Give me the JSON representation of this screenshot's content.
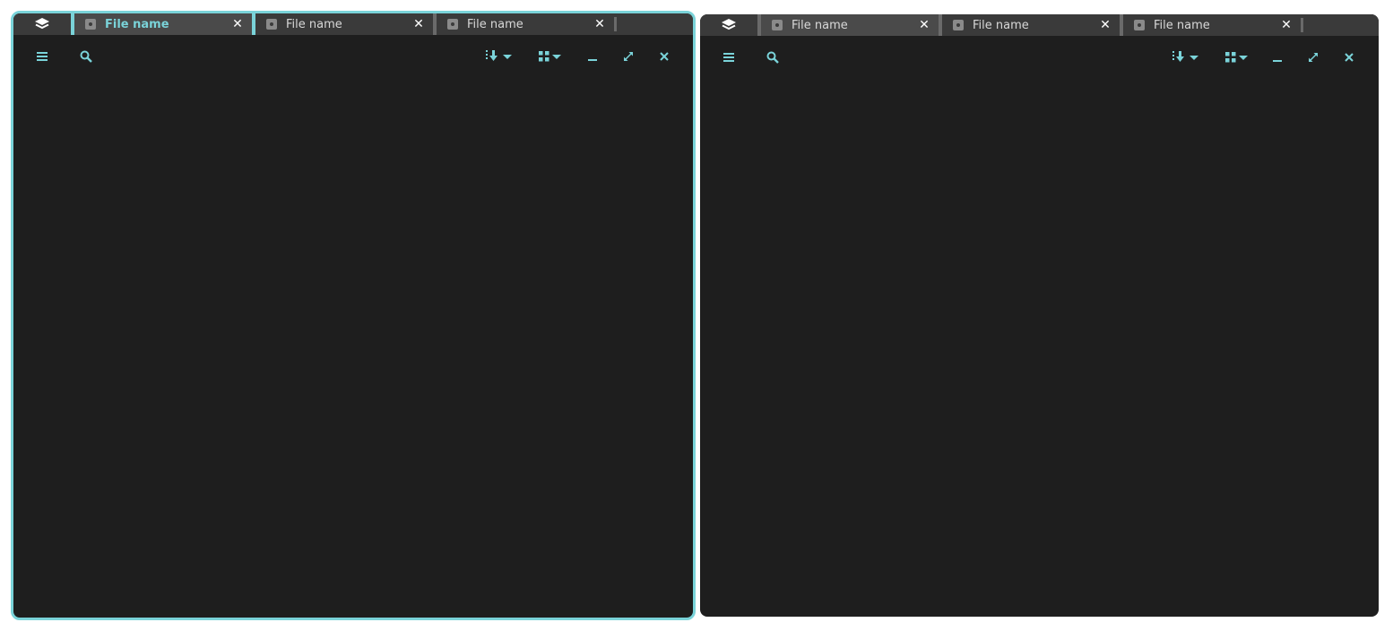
{
  "colors": {
    "accent": "#7ad3d9",
    "pane_bg": "#1e1e1e",
    "tabbar_bg": "#3a3a3a",
    "active_tab_bg": "#4a4a4a",
    "inactive_text": "#d8d8d8"
  },
  "panes": [
    {
      "focused": true,
      "tabs": [
        {
          "label": "File name",
          "active": true,
          "icon": "file-icon"
        },
        {
          "label": "File name",
          "active": false,
          "icon": "file-icon"
        },
        {
          "label": "File name",
          "active": false,
          "icon": "file-icon"
        }
      ],
      "toolbar": {
        "menu_icon": "menu-icon",
        "search_icon": "search-icon",
        "sort_icon": "sort-down-icon",
        "view_icon": "grid-view-icon",
        "minimize_icon": "minimize-icon",
        "expand_icon": "expand-icon",
        "close_icon": "close-icon"
      }
    },
    {
      "focused": false,
      "tabs": [
        {
          "label": "File name",
          "active": false,
          "icon": "file-icon"
        },
        {
          "label": "File name",
          "active": false,
          "icon": "file-icon"
        },
        {
          "label": "File name",
          "active": false,
          "icon": "file-icon"
        }
      ],
      "toolbar": {
        "menu_icon": "menu-icon",
        "search_icon": "search-icon",
        "sort_icon": "sort-down-icon",
        "view_icon": "grid-view-icon",
        "minimize_icon": "minimize-icon",
        "expand_icon": "expand-icon",
        "close_icon": "close-icon"
      }
    }
  ]
}
